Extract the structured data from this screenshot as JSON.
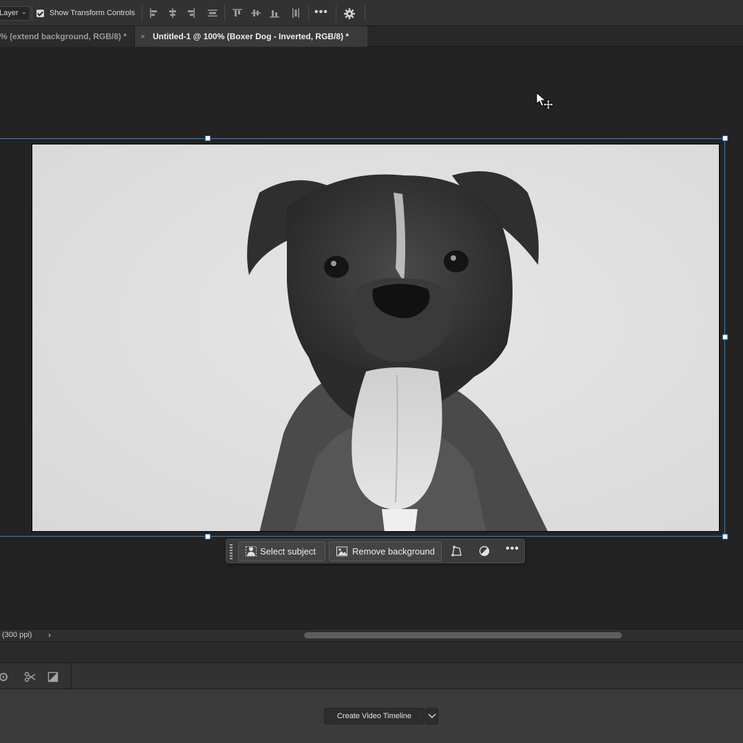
{
  "options_bar": {
    "layer_select_value": "Layer",
    "show_transform_controls_label": "Show Transform Controls",
    "show_transform_controls_checked": true,
    "more_label": "•••"
  },
  "tabs": [
    {
      "label": "% (extend background, RGB/8) *",
      "active": false
    },
    {
      "label": "Untitled-1 @ 100% (Boxer Dog - Inverted, RGB/8) *",
      "active": true,
      "close": "×"
    }
  ],
  "canvas": {
    "image_subject": "black-and-white boxer dog portrait",
    "selection_color": "#3b82c4"
  },
  "contextual_taskbar": {
    "select_subject_label": "Select subject",
    "remove_background_label": "Remove background",
    "more_label": "•••"
  },
  "status_bar": {
    "resolution_text": "(300 ppi)",
    "arrow": "›"
  },
  "timeline": {
    "create_video_timeline_label": "Create Video Timeline"
  }
}
